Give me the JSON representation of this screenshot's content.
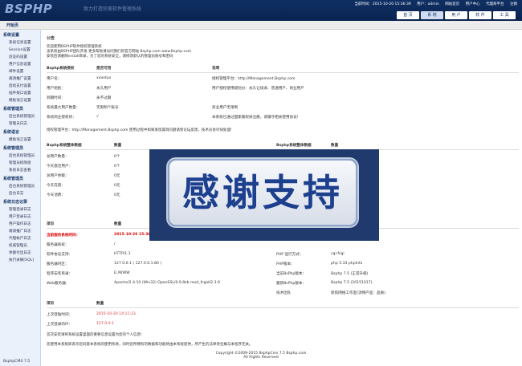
{
  "header": {
    "logo": "BSPHP",
    "slogan": "致力打造完美软件管理系统",
    "user_items": [
      "当前时间：2015-10-20 15:36:39",
      "用户：admin",
      "网站首页",
      "用户中心",
      "代理商平台",
      "注销"
    ],
    "tabs": [
      {
        "label": "首 页"
      },
      {
        "label": "系 统"
      },
      {
        "label": "用 户"
      },
      {
        "label": "软 件"
      },
      {
        "label": "工 具"
      }
    ],
    "active_tab": 1
  },
  "subnav": {
    "start_label": "开始页"
  },
  "sidebar": {
    "sections": [
      {
        "title": "系统设置",
        "items": [
          "系统信息设置",
          "Session设置",
          "验证码设置",
          "用户信息设置",
          "邮件设置",
          "邀请推广设置",
          "后续支付设置",
          "插件接口设置",
          "模板语言设置"
        ]
      },
      {
        "title": "系统管理员",
        "items": [
          "后台系统管理员",
          "管理员日志"
        ]
      },
      {
        "title": "系统语言",
        "items": [
          "模板语言设置"
        ]
      },
      {
        "title": "系统管理员",
        "items": [
          "后台系统管理员",
          "管理员权限组",
          "系统日志查看"
        ]
      },
      {
        "title": "系统管理员",
        "items": [
          "后台系统管理员",
          "后台日志"
        ]
      },
      {
        "title": "系统日志记录",
        "items": [
          "管理登录日志",
          "用户登录日志",
          "用户操作日志",
          "邀请推广日志",
          "代理帐户日志",
          "权威管理员",
          "余额付出日志",
          "执行关联[SQL]"
        ]
      }
    ],
    "version": "BsphpCMS 7.5"
  },
  "announcement": {
    "title": "公告",
    "lines": [
      "欢迎使用BSPHP软件授权管理系统",
      "该系统由BSPHP团队开发  更多帮助请访问我们的官方网站  Bsphp.com  www.Bsphp.com",
      "安装后请删除install目录，为了您的系统安全，请修改默认的管理员账号和密码"
    ]
  },
  "license_table": {
    "headers": [
      "Bsphp系统授权",
      "是否可用",
      "说明"
    ],
    "rows": [
      [
        "用户名：",
        "xiaoduo",
        "授权管理平台：http://Management.Bsphp.com"
      ],
      [
        "用户组别：",
        "永久用户",
        "用户授权使用级别分：永久让续收、普通用户、商业用户"
      ],
      [
        "到期时间：",
        "永不过期",
        ""
      ],
      [
        "系统最大用户数量：",
        "无限制个账号",
        "商业用户无限制"
      ],
      [
        "系统商业授权状：",
        "√",
        "本系统已通过国家版权局注册，请遵守相关使用协议!"
      ]
    ],
    "note": "授权管理平台：http://Management.Bsphp.com 使用过程中如果发现漏洞问题请到论坛反馈，技术员会尽快处理!"
  },
  "stats_table": {
    "headers": [
      "Bsphp系统整体数据",
      "数量",
      "Bsphp系统整体数据",
      "数量"
    ],
    "rows": [
      [
        "总用户数量：",
        "0个",
        "",
        ""
      ],
      [
        "今天激活用户：",
        "0个",
        "",
        ""
      ],
      [
        "总用户余额：",
        "0元",
        "",
        ""
      ],
      [
        "今天充值：",
        "0元",
        "",
        ""
      ],
      [
        "今天消费：",
        "0元",
        "",
        ""
      ]
    ]
  },
  "env_table": {
    "headers": [
      "项目",
      "数量",
      "项目",
      "数量"
    ],
    "rows": [
      [
        "当前服务系统时间：",
        "2015-10-20 15:36:39",
        "",
        ""
      ],
      [
        "服务器系统：",
        "/",
        "",
        ""
      ],
      [
        "软件协议支持：",
        "HTTP/1.1",
        "PHP 运行方式：",
        "cgi-fcgi"
      ],
      [
        "服务器时区：",
        "127.0.0.1 ( 127.0.0.1:80 )",
        "PHP版本：",
        "php 5.33    phpInfo"
      ],
      [
        "程序安装目录：",
        "E:/WWW",
        "当前BsPhp版本：",
        "Bsphp 7.5 (正常升级)"
      ],
      [
        "Web服务器：",
        "Apache/2.4.10 (Win32) OpenSSL/0.9.8zb mod_fcgid/2.3.9",
        "最新BsPhp版本：",
        "Bsphp 7.5 (20151017)"
      ],
      [
        "",
        "",
        "技术团队",
        "新航网络工作室(流畅产品：品质)"
      ]
    ]
  },
  "login_table": {
    "headers": [
      "项目",
      "数量"
    ],
    "rows": [
      [
        "上次登陆时间：",
        "2015-10-20 14:11:23"
      ],
      [
        "上次登录的IP：",
        "127.0.0.1"
      ]
    ]
  },
  "warnings": [
    "首次安装请将系统设置里面的重要信息设置为您的个人信息!",
    "您使用本系统即表示您同意本系统的使用条款，同时您所拥有的数据和功能将由本系统提供，所产生的法律责任概与本程序无关。"
  ],
  "overlay": {
    "text": "感谢支持"
  },
  "footer": {
    "line1": "Copyright ©2009-2015 BsphpCms 7.5 Bsphp.com",
    "line2": "All Rights Reserved"
  }
}
